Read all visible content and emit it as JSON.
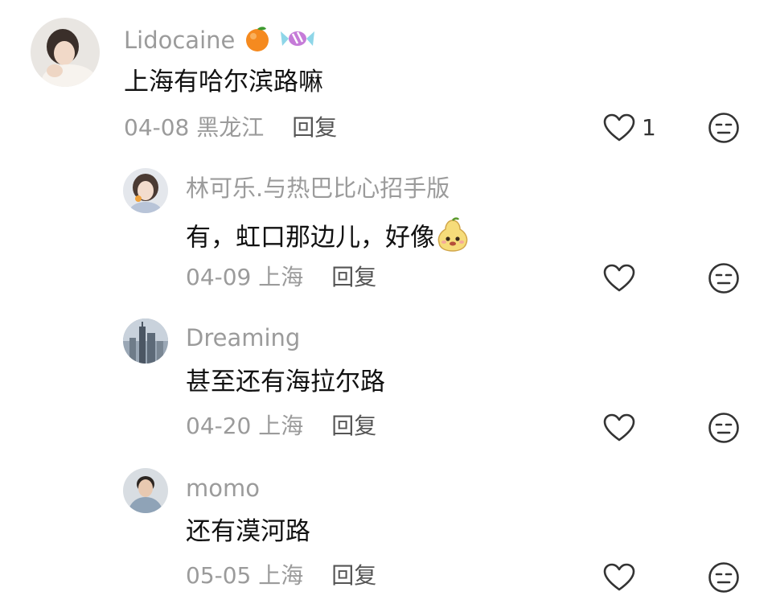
{
  "comments": [
    {
      "username": "Lidocaine",
      "text": "上海有哈尔滨路嘛",
      "date": "04-08",
      "location": "黑龙江",
      "reply_label": "回复",
      "like_count": "1",
      "name_emojis": [
        "tangerine-icon",
        "candy-icon"
      ]
    },
    {
      "username": "林可乐.与热巴比心招手版",
      "text": "有，虹口那边儿，好像",
      "text_emoji": "pear-face-icon",
      "date": "04-09",
      "location": "上海",
      "reply_label": "回复",
      "like_count": ""
    },
    {
      "username": "Dreaming",
      "text": "甚至还有海拉尔路",
      "date": "04-20",
      "location": "上海",
      "reply_label": "回复",
      "like_count": ""
    },
    {
      "username": "momo",
      "text": "还有漠河路",
      "date": "05-05",
      "location": "上海",
      "reply_label": "回复",
      "like_count": ""
    }
  ],
  "colors": {
    "username": "#9b9b9b",
    "text": "#111111",
    "meta": "#9b9b9b",
    "reply": "#555555",
    "icon": "#333333"
  }
}
